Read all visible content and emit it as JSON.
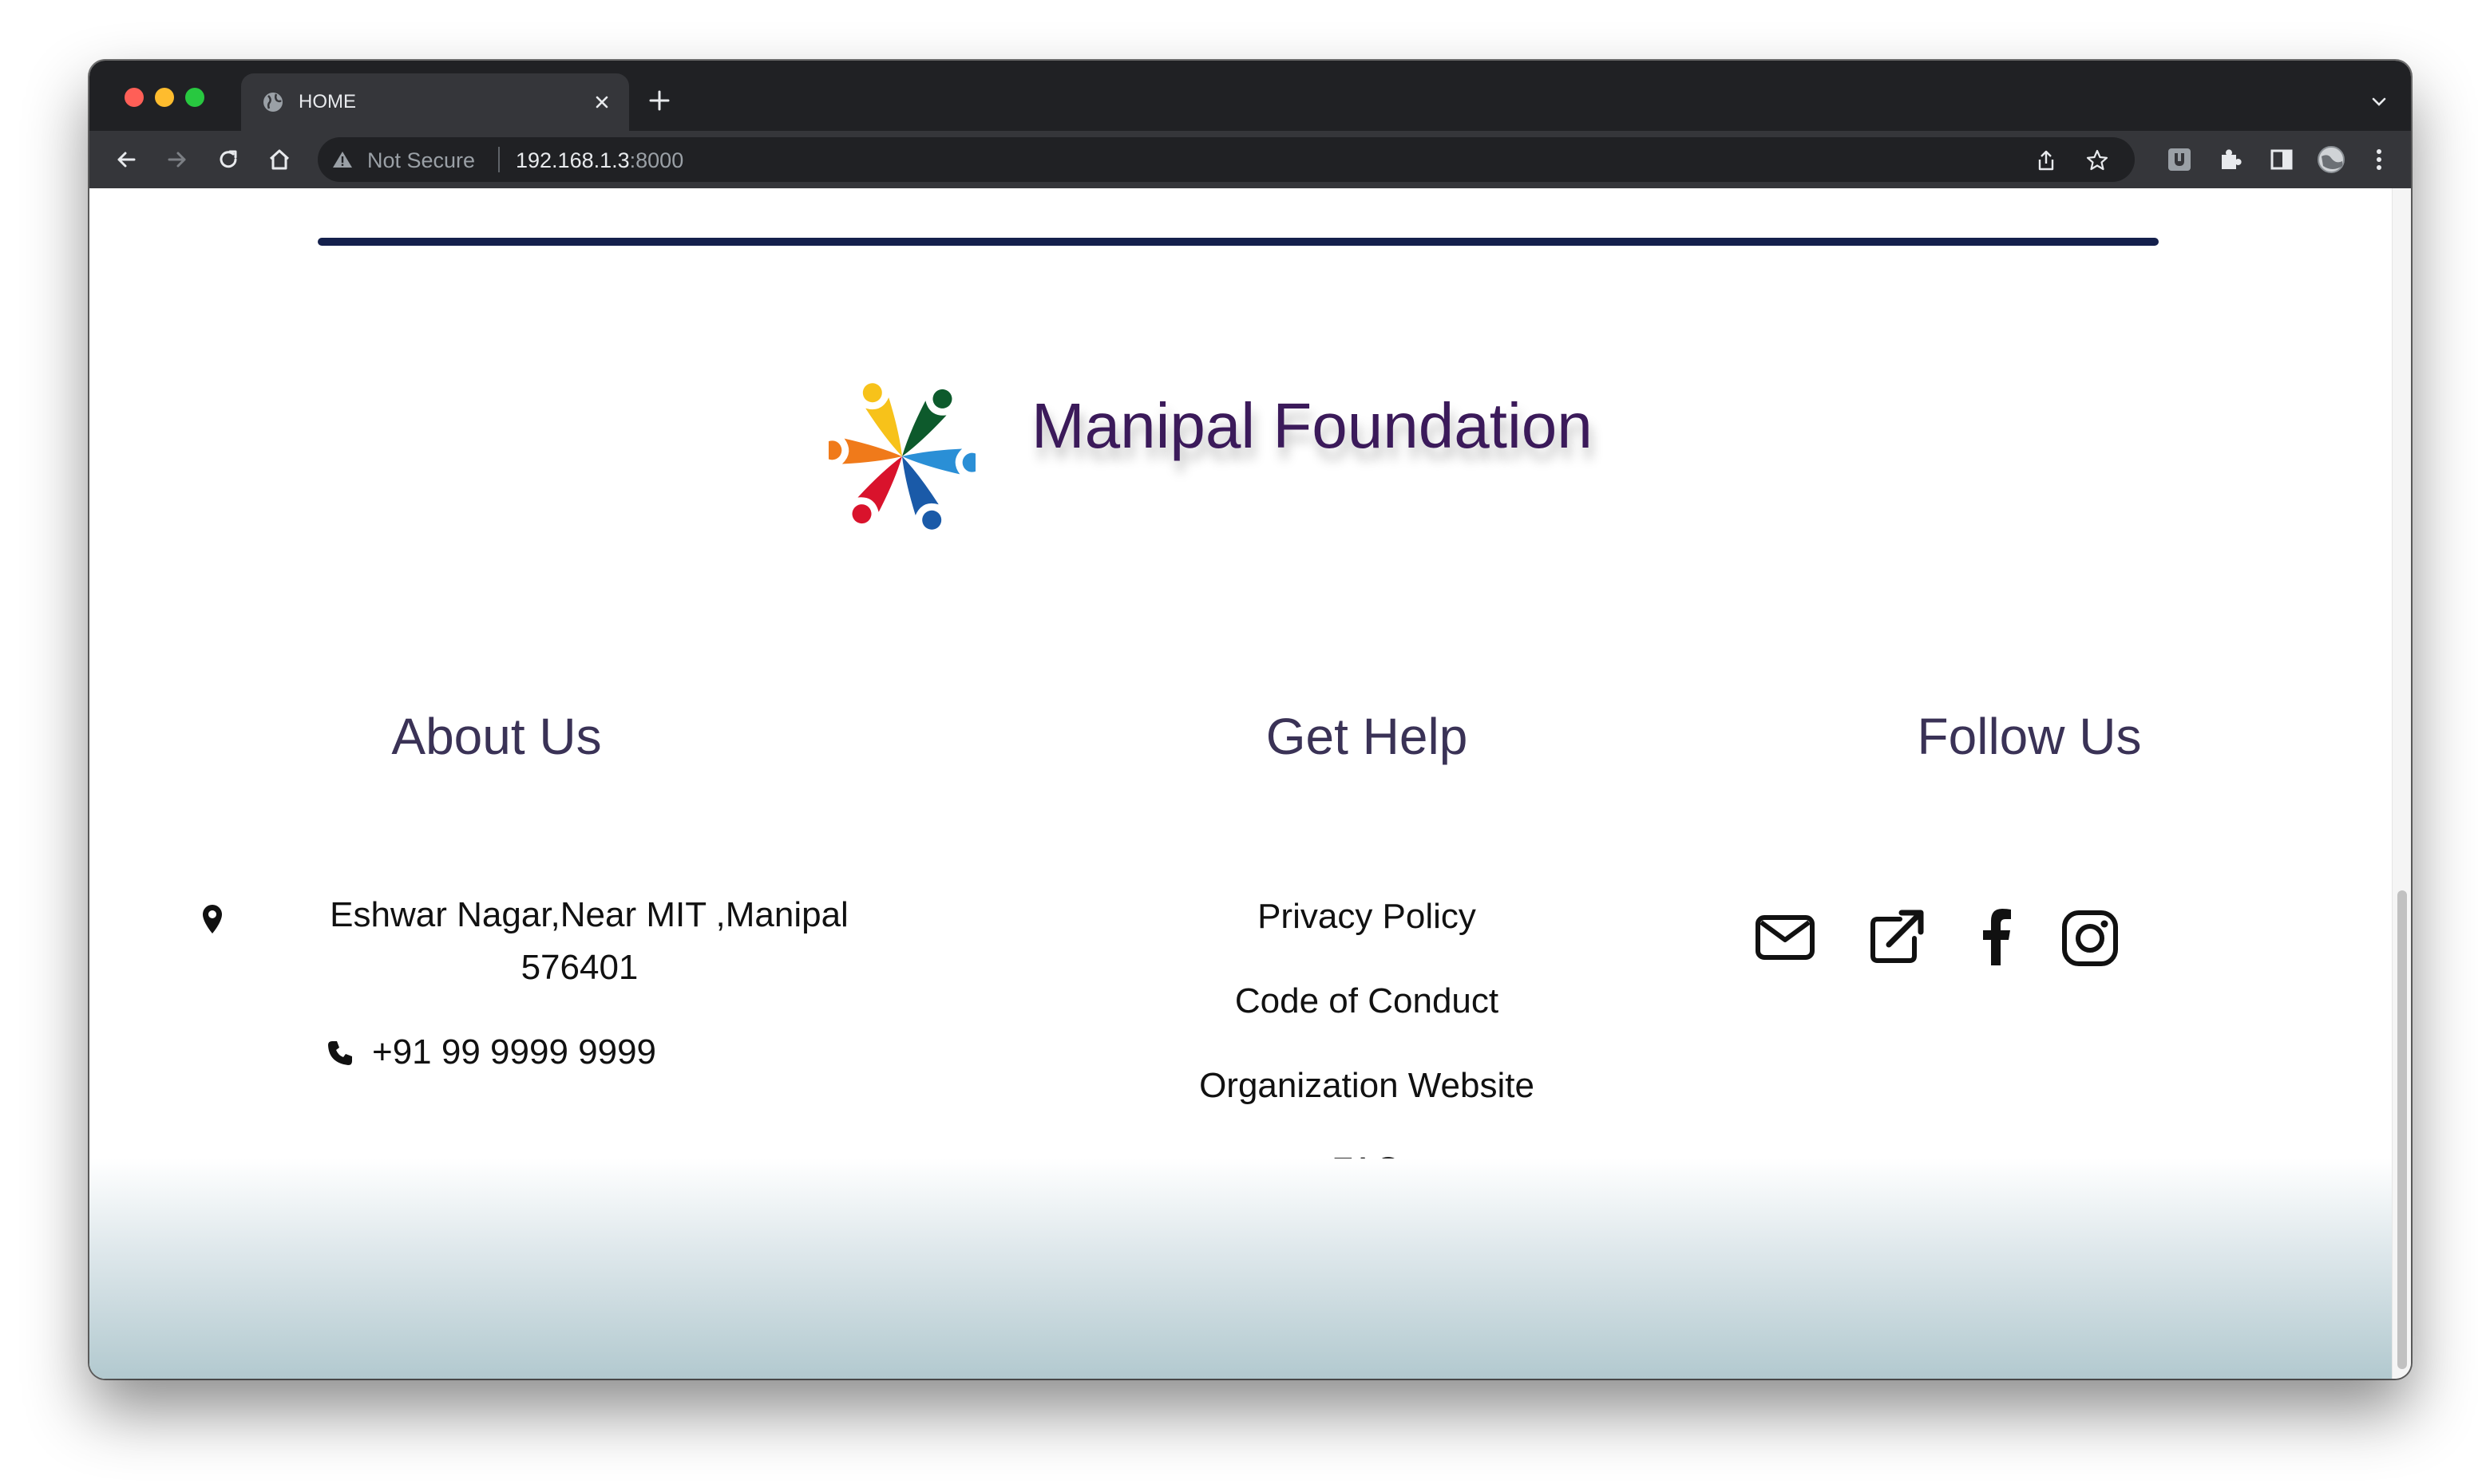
{
  "browser": {
    "tab_title": "HOME",
    "security_label": "Not Secure",
    "url_host": "192.168.1.3",
    "url_port": ":8000"
  },
  "brand": {
    "name": "Manipal Foundation",
    "logo_colors": [
      "#f7c21a",
      "#0d5a2c",
      "#2a8fd6",
      "#1a5aa8",
      "#d9132c",
      "#f07a1a"
    ],
    "title_color": "#3b1a5a"
  },
  "about": {
    "title": "About Us",
    "address_line1": "Eshwar Nagar,Near MIT ,Manipal",
    "address_line2": "576401",
    "phone": "+91 99 9999 9999"
  },
  "help": {
    "title": "Get Help",
    "links": [
      "Privacy Policy",
      "Code of Conduct",
      "Organization Website",
      "FAQ"
    ]
  },
  "follow": {
    "title": "Follow Us",
    "icons": [
      "envelope-icon",
      "external-link-icon",
      "facebook-icon",
      "instagram-icon"
    ]
  },
  "colors": {
    "divider": "#14204c",
    "heading": "#3a3256",
    "footer_gradient_end": "#b2c9cf"
  }
}
